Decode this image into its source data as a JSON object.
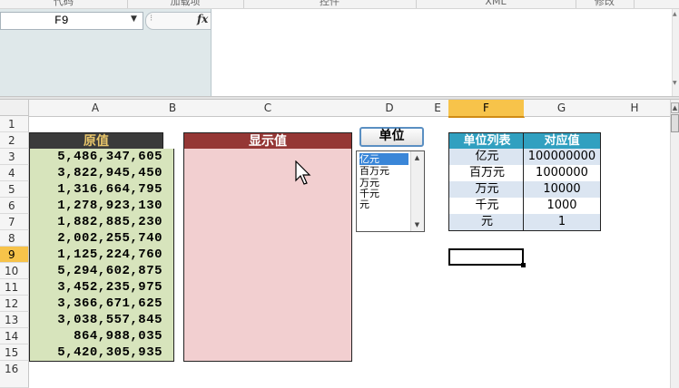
{
  "ribbon": {
    "groups": [
      "代码",
      "加载项",
      "控件",
      "XML",
      "修改"
    ]
  },
  "formula_bar": {
    "name_box": "F9",
    "fx": "fx"
  },
  "columns": [
    "A",
    "B",
    "C",
    "D",
    "E",
    "F",
    "G",
    "H"
  ],
  "selected_column": "F",
  "rows": [
    "1",
    "2",
    "3",
    "4",
    "5",
    "6",
    "7",
    "8",
    "9",
    "10",
    "11",
    "12",
    "13",
    "14",
    "15",
    "16"
  ],
  "selected_row": "9",
  "sheet": {
    "original_header": "原值",
    "original_values": [
      "5,486,347,605",
      "3,822,945,450",
      "1,316,664,795",
      "1,278,923,130",
      "1,882,885,230",
      "2,002,255,740",
      "1,125,224,760",
      "5,294,602,875",
      "3,452,235,975",
      "3,366,671,625",
      "3,038,557,845",
      "864,988,035",
      "5,420,305,935"
    ],
    "display_header": "显示值",
    "unit_button": "单位",
    "unit_list": [
      "亿元",
      "百万元",
      "万元",
      "千元",
      "元"
    ],
    "unit_list_selected": "亿元",
    "unit_table": {
      "headers": [
        "单位列表",
        "对应值"
      ],
      "rows": [
        [
          "亿元",
          "100000000"
        ],
        [
          "百万元",
          "1000000"
        ],
        [
          "万元",
          "10000"
        ],
        [
          "千元",
          "1000"
        ],
        [
          "元",
          "1"
        ]
      ]
    }
  },
  "colors": {
    "original_header_bg": "#3b3b3b",
    "original_header_text": "#e8c56a",
    "original_cells_bg": "#d7e4bc",
    "display_header_bg": "#953735",
    "display_cells_bg": "#f2cfd0",
    "unit_table_header_bg": "#31a0c0",
    "unit_table_alt_bg": "#dbe5f1",
    "selection_header": "#f7c34a"
  }
}
